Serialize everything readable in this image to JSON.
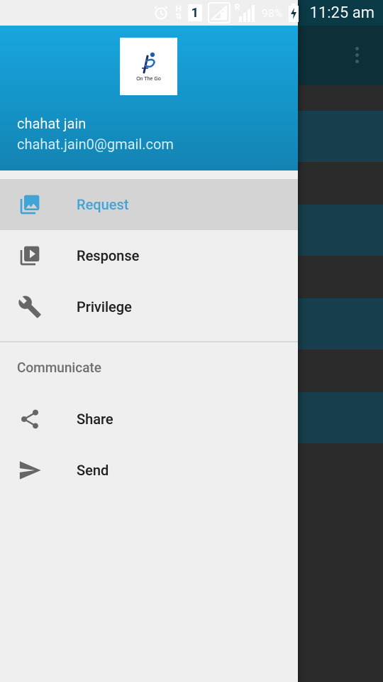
{
  "status_bar": {
    "battery_percent": "98%",
    "time": "11:25 am",
    "network_labels": {
      "h": "H",
      "sim": "1",
      "roaming": "R"
    }
  },
  "drawer": {
    "header": {
      "logo_text": "On The Go",
      "user_name": "chahat jain",
      "user_email": "chahat.jain0@gmail.com"
    },
    "items": [
      {
        "label": "Request",
        "icon": "photo-library-icon",
        "selected": true
      },
      {
        "label": "Response",
        "icon": "video-library-icon",
        "selected": false
      },
      {
        "label": "Privilege",
        "icon": "wrench-icon",
        "selected": false
      }
    ],
    "section": {
      "title": "Communicate",
      "items": [
        {
          "label": "Share",
          "icon": "share-icon"
        },
        {
          "label": "Send",
          "icon": "send-icon"
        }
      ]
    }
  },
  "colors": {
    "header_gradient_top": "#17a7df",
    "header_gradient_bottom": "#1383b3",
    "selected_text": "#42a4d6",
    "selected_bg": "#d4d4d4",
    "drawer_bg": "#efefef",
    "icon_gray": "#666666"
  }
}
